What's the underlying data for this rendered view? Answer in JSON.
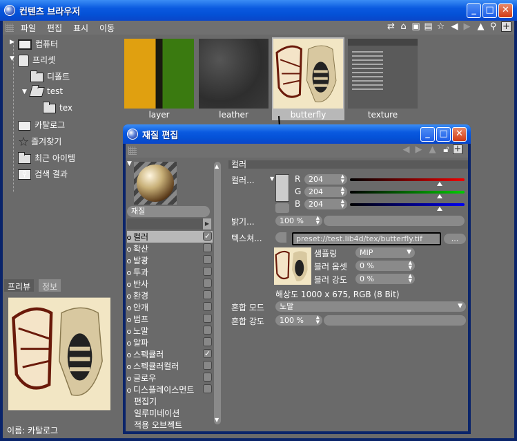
{
  "window": {
    "title": "컨텐츠 브라우저"
  },
  "menu": [
    "파일",
    "편집",
    "표시",
    "이동"
  ],
  "tree": {
    "computer": "컴퓨터",
    "preset": "프리셋",
    "default": "디폴트",
    "test": "test",
    "tex": "tex",
    "catalog": "카탈로그",
    "favorites": "즐겨찾기",
    "recent": "최근 아이템",
    "search": "검색 결과"
  },
  "thumbnails": [
    "layer",
    "leather",
    "butterfly",
    "texture"
  ],
  "preview": {
    "tab_preview": "프리뷰",
    "tab_info": "정보",
    "name_label": "이름: 카탈로그"
  },
  "dialog": {
    "title": "재질 편집",
    "material_name": "재질",
    "channels": [
      {
        "label": "컬러",
        "checked": true,
        "selected": true
      },
      {
        "label": "확산",
        "checked": false
      },
      {
        "label": "발광",
        "checked": false
      },
      {
        "label": "투과",
        "checked": false
      },
      {
        "label": "반사",
        "checked": false
      },
      {
        "label": "환경",
        "checked": false
      },
      {
        "label": "안개",
        "checked": false
      },
      {
        "label": "범프",
        "checked": false
      },
      {
        "label": "노말",
        "checked": false
      },
      {
        "label": "알파",
        "checked": false
      },
      {
        "label": "스펙큘러",
        "checked": true
      },
      {
        "label": "스펙큘러컬러",
        "checked": false
      },
      {
        "label": "글로우",
        "checked": false
      },
      {
        "label": "디스플레이스먼트",
        "checked": false
      }
    ],
    "extra_items": [
      "편집기",
      "일루미네이션",
      "적용 오브젝트"
    ],
    "section_title": "컬러",
    "color_label": "컬러...",
    "r_label": "R",
    "r_value": "204",
    "g_label": "G",
    "g_value": "204",
    "b_label": "B",
    "b_value": "204",
    "brightness_label": "밝기...",
    "brightness_value": "100 %",
    "texture_label": "텍스쳐...",
    "texture_path": "preset://test.lib4d/tex/butterfly.tif",
    "texture_browse": "...",
    "sampling_label": "샘플링",
    "sampling_value": "MIP",
    "blur_offset_label": "블러 옵셋",
    "blur_offset_value": "0 %",
    "blur_strength_label": "블러 강도",
    "blur_strength_value": "0 %",
    "resolution": "해상도 1000 x 675, RGB (8 Bit)",
    "mix_mode_label": "혼합 모드",
    "mix_mode_value": "노말",
    "mix_strength_label": "혼합 강도",
    "mix_strength_value": "100 %"
  },
  "colors": {
    "accent": "#0a5ae0",
    "panel": "#6a6a6a",
    "selected": "#b8b8b8"
  }
}
